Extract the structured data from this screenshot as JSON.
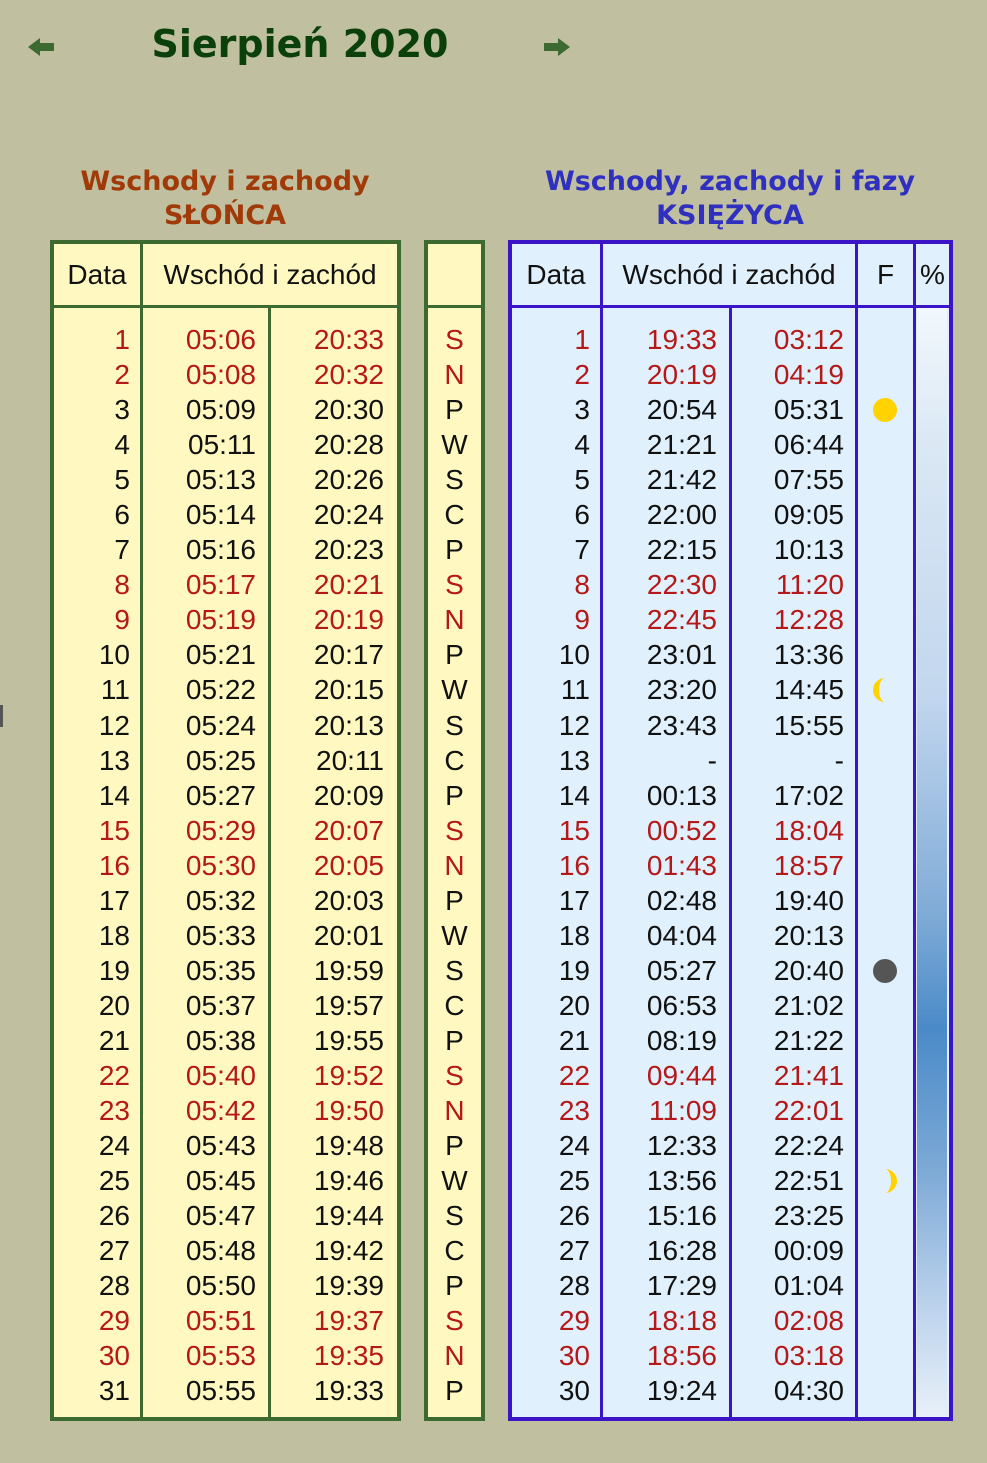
{
  "month_title": "Sierpień 2020",
  "sun": {
    "heading_line1": "Wschody i zachody",
    "heading_line2": "SŁOŃCA",
    "col_date": "Data",
    "col_rise_set": "Wschód i zachód",
    "days": [
      "1",
      "2",
      "3",
      "4",
      "5",
      "6",
      "7",
      "8",
      "9",
      "10",
      "11",
      "12",
      "13",
      "14",
      "15",
      "16",
      "17",
      "18",
      "19",
      "20",
      "21",
      "22",
      "23",
      "24",
      "25",
      "26",
      "27",
      "28",
      "29",
      "30",
      "31"
    ],
    "rise": [
      "05:06",
      "05:08",
      "05:09",
      "05:11",
      "05:13",
      "05:14",
      "05:16",
      "05:17",
      "05:19",
      "05:21",
      "05:22",
      "05:24",
      "05:25",
      "05:27",
      "05:29",
      "05:30",
      "05:32",
      "05:33",
      "05:35",
      "05:37",
      "05:38",
      "05:40",
      "05:42",
      "05:43",
      "05:45",
      "05:47",
      "05:48",
      "05:50",
      "05:51",
      "05:53",
      "05:55"
    ],
    "set": [
      "20:33",
      "20:32",
      "20:30",
      "20:28",
      "20:26",
      "20:24",
      "20:23",
      "20:21",
      "20:19",
      "20:17",
      "20:15",
      "20:13",
      "20:11",
      "20:09",
      "20:07",
      "20:05",
      "20:03",
      "20:01",
      "19:59",
      "19:57",
      "19:55",
      "19:52",
      "19:50",
      "19:48",
      "19:46",
      "19:44",
      "19:42",
      "19:39",
      "19:37",
      "19:35",
      "19:33"
    ]
  },
  "weekdays": [
    "S",
    "N",
    "P",
    "W",
    "S",
    "C",
    "P",
    "S",
    "N",
    "P",
    "W",
    "S",
    "C",
    "P",
    "S",
    "N",
    "P",
    "W",
    "S",
    "C",
    "P",
    "S",
    "N",
    "P",
    "W",
    "S",
    "C",
    "P",
    "S",
    "N",
    "P"
  ],
  "highlight_rows": [
    1,
    2,
    8,
    9,
    15,
    16,
    22,
    23,
    29,
    30
  ],
  "moon": {
    "heading_line1": "Wschody, zachody i fazy",
    "heading_line2": "KSIĘŻYCA",
    "col_date": "Data",
    "col_rise_set": "Wschód i zachód",
    "col_phase": "F",
    "col_percent": "%",
    "days": [
      "1",
      "2",
      "3",
      "4",
      "5",
      "6",
      "7",
      "8",
      "9",
      "10",
      "11",
      "12",
      "13",
      "14",
      "15",
      "16",
      "17",
      "18",
      "19",
      "20",
      "21",
      "22",
      "23",
      "24",
      "25",
      "26",
      "27",
      "28",
      "29",
      "30",
      "30"
    ],
    "rise": [
      "19:33",
      "20:19",
      "20:54",
      "21:21",
      "21:42",
      "22:00",
      "22:15",
      "22:30",
      "22:45",
      "23:01",
      "23:20",
      "23:43",
      "-",
      "00:13",
      "00:52",
      "01:43",
      "02:48",
      "04:04",
      "05:27",
      "06:53",
      "08:19",
      "09:44",
      "11:09",
      "12:33",
      "13:56",
      "15:16",
      "16:28",
      "17:29",
      "18:18",
      "18:56",
      "19:24"
    ],
    "set": [
      "03:12",
      "04:19",
      "05:31",
      "06:44",
      "07:55",
      "09:05",
      "10:13",
      "11:20",
      "12:28",
      "13:36",
      "14:45",
      "15:55",
      "-",
      "17:02",
      "18:04",
      "18:57",
      "19:40",
      "20:13",
      "20:40",
      "21:02",
      "21:22",
      "21:41",
      "22:01",
      "22:24",
      "22:51",
      "23:25",
      "00:09",
      "01:04",
      "02:08",
      "03:18",
      "04:30"
    ],
    "phases": [
      {
        "day": 3,
        "phase": "full-moon-icon"
      },
      {
        "day": 11,
        "phase": "last-quarter-icon"
      },
      {
        "day": 19,
        "phase": "new-moon-icon"
      },
      {
        "day": 25,
        "phase": "first-quarter-icon"
      }
    ]
  },
  "colors": {
    "background": "#c0c0a0",
    "title": "#0b400b",
    "sun_heading": "#a03a08",
    "moon_heading": "#3030c0",
    "sun_panel": "#fff8c0",
    "sun_border": "#3c6a30",
    "moon_panel": "#e0f0fc",
    "moon_border": "#3c14c8",
    "weekend_text": "#b41818",
    "moon_phase_fill": "#ffd200",
    "new_moon_fill": "#555555"
  }
}
